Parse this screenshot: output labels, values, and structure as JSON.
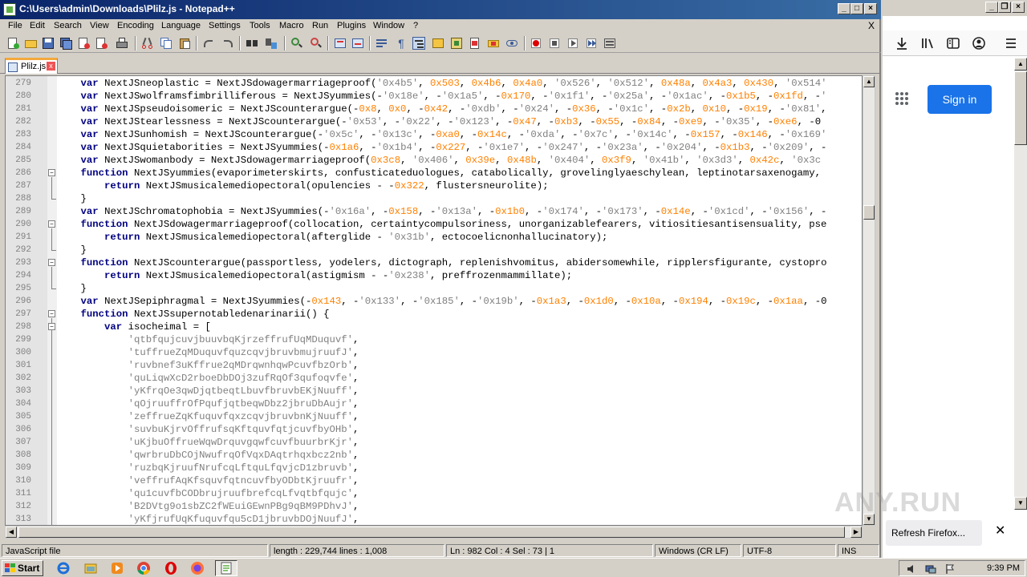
{
  "notepad": {
    "title": "C:\\Users\\admin\\Downloads\\Plilz.js - Notepad++",
    "menu": [
      "File",
      "Edit",
      "Search",
      "View",
      "Encoding",
      "Language",
      "Settings",
      "Tools",
      "Macro",
      "Run",
      "Plugins",
      "Window",
      "?"
    ],
    "menu_close": "X",
    "tab": {
      "label": "Plilz.js",
      "close": "x"
    },
    "lines": [
      {
        "no": "279",
        "text": "    var NextJSneoplastic = NextJSdowagermarriageproof('0x4b5', 0x503, 0x4b6, 0x4a0, '0x526', '0x512', 0x48a, 0x4a3, 0x430, '0x514'"
      },
      {
        "no": "280",
        "text": "    var NextJSwolframsfimbrilliferous = NextJSyummies(-'0x18e', -'0x1a5', -0x170, -'0x1f1', -'0x25a', -'0x1ac', -0x1b5, -0x1fd, -'"
      },
      {
        "no": "281",
        "text": "    var NextJSpseudoisomeric = NextJScounterargue(-0x8, 0x0, -0x42, -'0xdb', -'0x24', -0x36, -'0x1c', -0x2b, 0x10, -0x19, -'0x81',"
      },
      {
        "no": "282",
        "text": "    var NextJStearlessness = NextJScounterargue(-'0x53', -'0x22', -'0x123', -0x47, -0xb3, -0x55, -0x84, -0xe9, -'0x35', -0xe6, -0x"
      },
      {
        "no": "283",
        "text": "    var NextJSunhomish = NextJScounterargue(-'0x5c', -'0x13c', -0xa0, -0x14c, -'0xda', -'0x7c', -'0x14c', -0x157, -0x146, -'0x169'"
      },
      {
        "no": "284",
        "text": "    var NextJSquietaborities = NextJSyummies(-0x1a6, -'0x1b4', -0x227, -'0x1e7', -'0x247', -'0x23a', -'0x204', -0x1b3, -'0x209', -"
      },
      {
        "no": "285",
        "text": "    var NextJSwomanbody = NextJSdowagermarriageproof(0x3c8, '0x406', 0x39e, 0x48b, '0x404', 0x3f9, '0x41b', '0x3d3', 0x42c, '0x3c"
      },
      {
        "no": "286",
        "text": "    function NextJSyummies(evaporimeterskirts, confusticateduologues, catabolically, grovelinglyaeschylean, leptinotarsaxenogamy,"
      },
      {
        "no": "287",
        "text": "        return NextJSmusicalemediopectoral(opulencies - -0x322, flustersneurolite);"
      },
      {
        "no": "288",
        "text": "    }"
      },
      {
        "no": "289",
        "text": "    var NextJSchromatophobia = NextJSyummies(-'0x16a', -0x158, -'0x13a', -0x1b0, -'0x174', -'0x173', -0x14e, -'0x1cd', -'0x156', -"
      },
      {
        "no": "290",
        "text": "    function NextJSdowagermarriageproof(collocation, certaintycompulsoriness, unorganizablefearers, vitiositiesantisensuality, pse"
      },
      {
        "no": "291",
        "text": "        return NextJSmusicalemediopectoral(afterglide - '0x31b', ectocoelicnonhallucinatory);"
      },
      {
        "no": "292",
        "text": "    }"
      },
      {
        "no": "293",
        "text": "    function NextJScounterargue(passportless, yodelers, dictograph, replenishvomitus, abidersomewhile, ripplersfigurante, cystopro"
      },
      {
        "no": "294",
        "text": "        return NextJSmusicalemediopectoral(astigmism - -'0x238', preffrozenmammillate);"
      },
      {
        "no": "295",
        "text": "    }"
      },
      {
        "no": "296",
        "text": "    var NextJSepiphragmal = NextJSyummies(-0x143, -'0x133', -'0x185', -'0x19b', -0x1a3, -0x1d0, -0x10a, -0x194, -0x19c, -0x1aa, -0"
      },
      {
        "no": "297",
        "text": "    function NextJSsupernotabledenarinarii() {"
      },
      {
        "no": "298",
        "text": "        var isocheimal = ["
      },
      {
        "no": "299",
        "text": "            'qtbfqujcuvjbuuvbqKjrzeffrufUqMDuquvf',"
      },
      {
        "no": "300",
        "text": "            'tuffrueZqMDuquvfquzcqvjbruvbmujruufJ',"
      },
      {
        "no": "301",
        "text": "            'ruvbnef3uKffrue2qMDrqwnhqwPcuvfbzOrb',"
      },
      {
        "no": "302",
        "text": "            'quLiqwXcD2rboeDbDOj3zufRqOf3qufoqvfe',"
      },
      {
        "no": "303",
        "text": "            'yKfrqOe3qwDjqtbeqtLbuvfbruvbEKjNuuff',"
      },
      {
        "no": "304",
        "text": "            'qOjruuffrOfPqufjqtbeqwDbz2jbruDbAujr',"
      },
      {
        "no": "305",
        "text": "            'zeffrueZqKfuquvfqxzcqvjbruvbnKjNuuff',"
      },
      {
        "no": "306",
        "text": "            'suvbuKjrvOffrufsqKftquvfqtjcuvfbyOHb',"
      },
      {
        "no": "307",
        "text": "            'uKjbuOffrueWqwDrquvgqwfcuvfbuurbrKjr',"
      },
      {
        "no": "308",
        "text": "            'qwrbruDbCOjNwufrqOfVqxDAqtrhqxbcz2nb',"
      },
      {
        "no": "309",
        "text": "            'ruzbqKjruufNrufcqLftquLfqvjcD1zbruvb',"
      },
      {
        "no": "310",
        "text": "            'veffrufAqKfsquvfqtncuvfbyODbtKjruufr',"
      },
      {
        "no": "311",
        "text": "            'qu1cuvfbCODbrujruufbrefcqLfvqtbfqujc',"
      },
      {
        "no": "312",
        "text": "            'B2DVtg9o1sbZC2fWEuiGEwnPBg9qBM9PDhvJ',"
      },
      {
        "no": "313",
        "text": "            'yKfjrufUqKfuquvfqu5cD1jbruvbDOjNuufJ',"
      }
    ],
    "status": {
      "filetype": "JavaScript file",
      "length": "length : 229,744    lines : 1,008",
      "position": "Ln : 982    Col : 4    Sel : 73 | 1",
      "eol": "Windows (CR LF)",
      "encoding": "UTF-8",
      "mode": "INS"
    }
  },
  "firefox": {
    "signin_label": "Sign in",
    "notification": "Refresh Firefox...",
    "notification_close": "✕",
    "watermark": "ANY.RUN"
  },
  "taskbar": {
    "start_label": "Start",
    "clock": "9:39 PM"
  },
  "colors": {
    "keyword": "#000080",
    "number": "#ff8000",
    "string": "#808080",
    "title_start": "#0a246a",
    "title_end": "#3a6ea5",
    "signin": "#1a73e8"
  }
}
